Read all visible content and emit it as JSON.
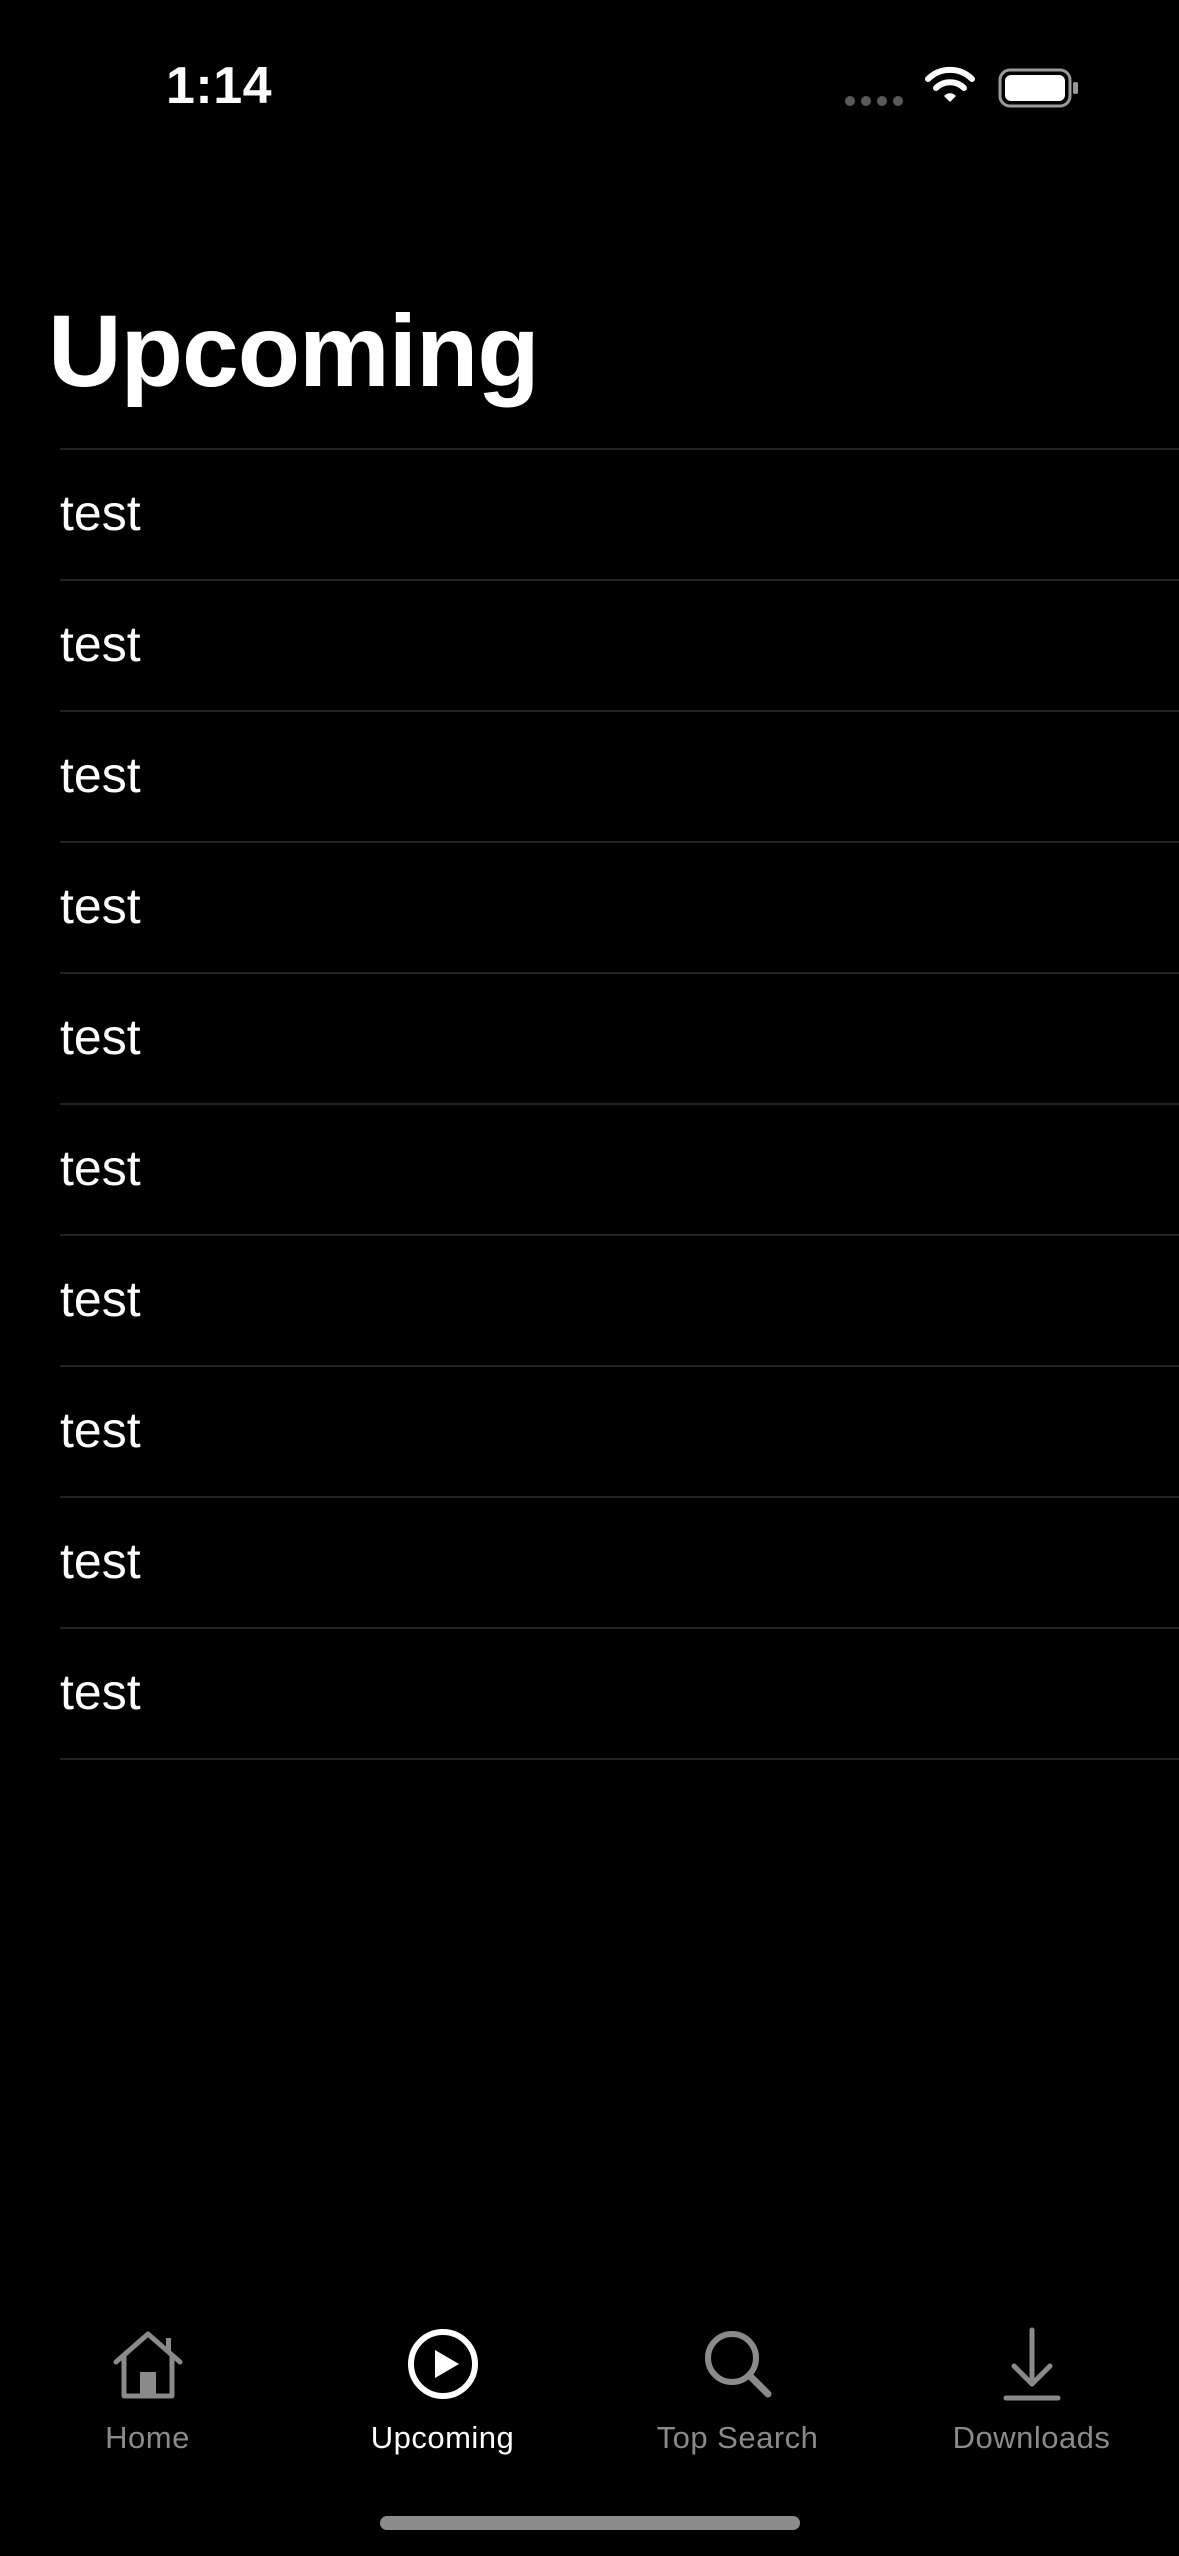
{
  "status_bar": {
    "time": "1:14",
    "icons": [
      "cellular-signal-icon",
      "wifi-icon",
      "battery-icon"
    ]
  },
  "page": {
    "title": "Upcoming"
  },
  "list": {
    "items": [
      {
        "label": "test"
      },
      {
        "label": "test"
      },
      {
        "label": "test"
      },
      {
        "label": "test"
      },
      {
        "label": "test"
      },
      {
        "label": "test"
      },
      {
        "label": "test"
      },
      {
        "label": "test"
      },
      {
        "label": "test"
      },
      {
        "label": "test"
      }
    ]
  },
  "tab_bar": {
    "active_tab": "Upcoming",
    "tabs": [
      {
        "label": "Home",
        "icon": "house-icon"
      },
      {
        "label": "Upcoming",
        "icon": "play-circle-icon"
      },
      {
        "label": "Top Search",
        "icon": "magnifying-glass-icon"
      },
      {
        "label": "Downloads",
        "icon": "arrow-down-to-line-icon"
      }
    ]
  },
  "colors": {
    "background": "#000000",
    "text_primary": "#ffffff",
    "tab_inactive": "#8a8a8a",
    "separator": "#222222"
  }
}
